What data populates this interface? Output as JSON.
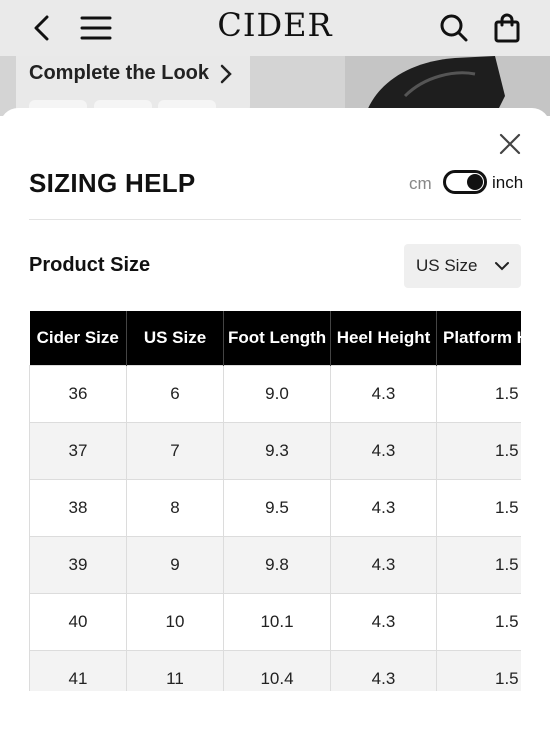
{
  "header": {
    "logo": "CIDER"
  },
  "backdrop": {
    "ctl_label": "Complete the Look"
  },
  "sheet": {
    "title": "SIZING HELP",
    "unit_left": "cm",
    "unit_right": "inch",
    "unit_selected": "inch",
    "product_size_label": "Product Size",
    "size_select_value": "US Size"
  },
  "table": {
    "headers": [
      "Cider Size",
      "US Size",
      "Foot Length",
      "Heel Height",
      "Platform Height"
    ],
    "rows": [
      [
        "36",
        "6",
        "9.0",
        "4.3",
        "1.5"
      ],
      [
        "37",
        "7",
        "9.3",
        "4.3",
        "1.5"
      ],
      [
        "38",
        "8",
        "9.5",
        "4.3",
        "1.5"
      ],
      [
        "39",
        "9",
        "9.8",
        "4.3",
        "1.5"
      ],
      [
        "40",
        "10",
        "10.1",
        "4.3",
        "1.5"
      ],
      [
        "41",
        "11",
        "10.4",
        "4.3",
        "1.5"
      ]
    ]
  },
  "icons": [
    "back-icon",
    "menu-icon",
    "search-icon",
    "bag-icon",
    "close-icon",
    "chevron-right-icon",
    "chevron-down-icon"
  ]
}
